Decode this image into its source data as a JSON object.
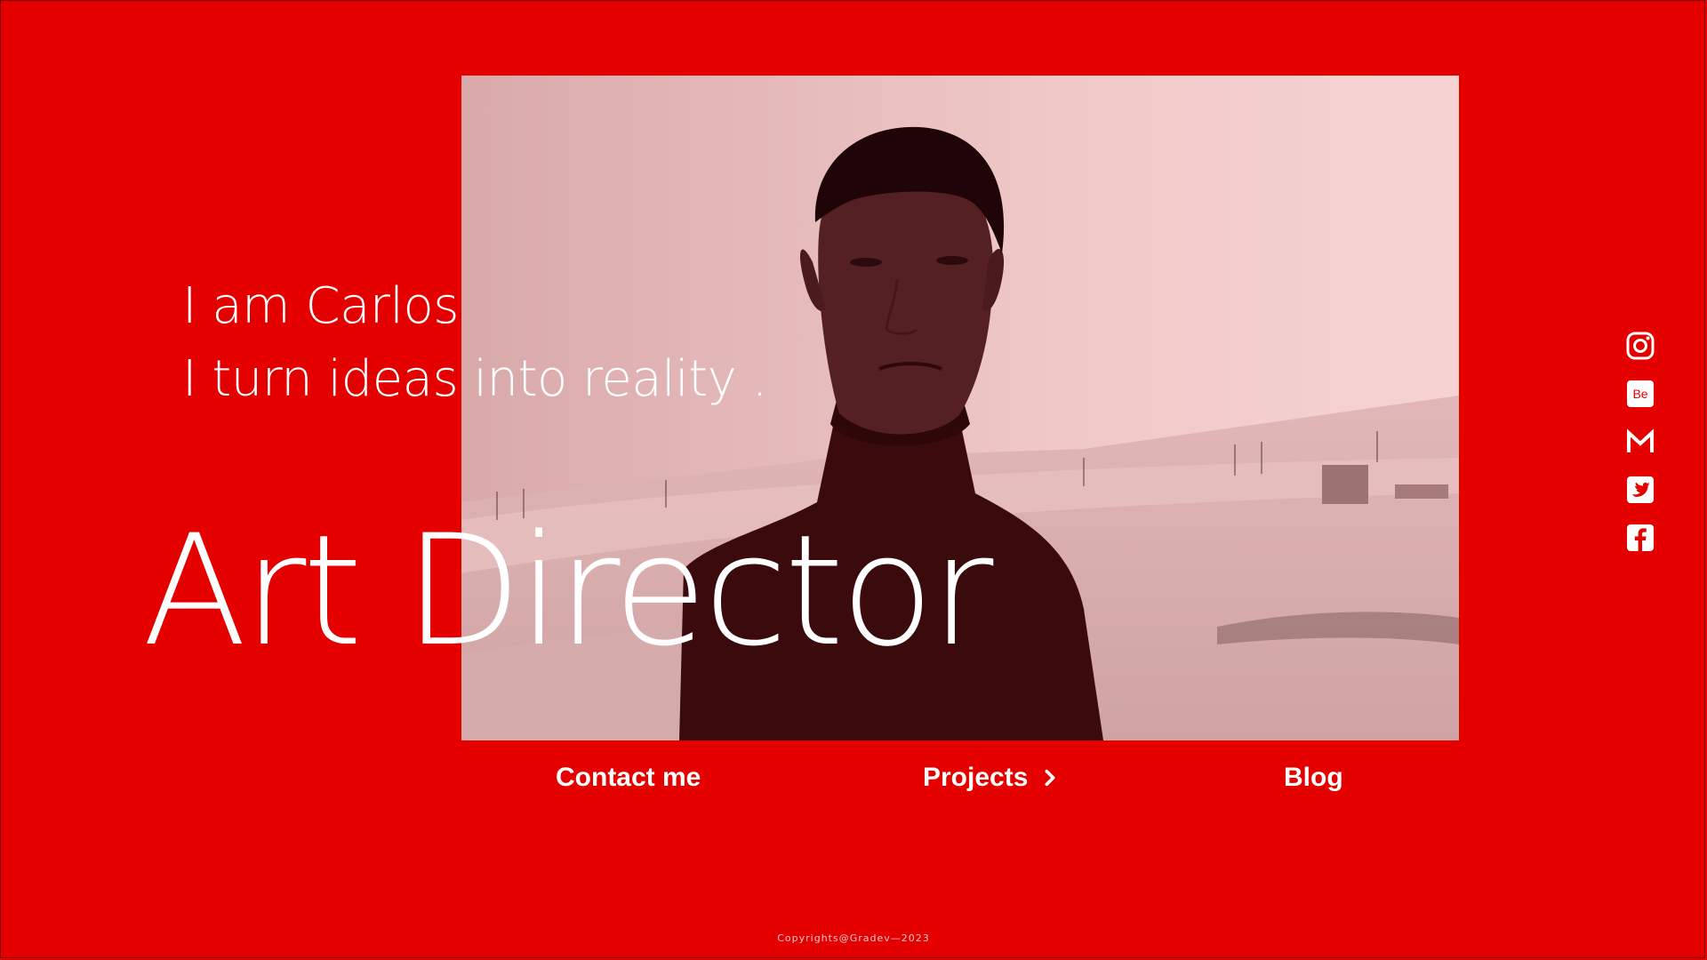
{
  "hero": {
    "greeting": "I am Carlos",
    "tagline": "I turn ideas into reality .",
    "role": "Art Director"
  },
  "nav": {
    "contact_label": "Contact me",
    "projects_label": "Projects",
    "blog_label": "Blog"
  },
  "social": [
    {
      "icon": "instagram-icon"
    },
    {
      "icon": "behance-icon",
      "label": "Be"
    },
    {
      "icon": "gmail-icon"
    },
    {
      "icon": "twitter-icon"
    },
    {
      "icon": "facebook-icon"
    }
  ],
  "footer": {
    "copyright": "Copyrights@Gradev—2023"
  },
  "colors": {
    "background": "#e50000",
    "text": "#ffffff",
    "photo_tint": "#f3caca"
  }
}
